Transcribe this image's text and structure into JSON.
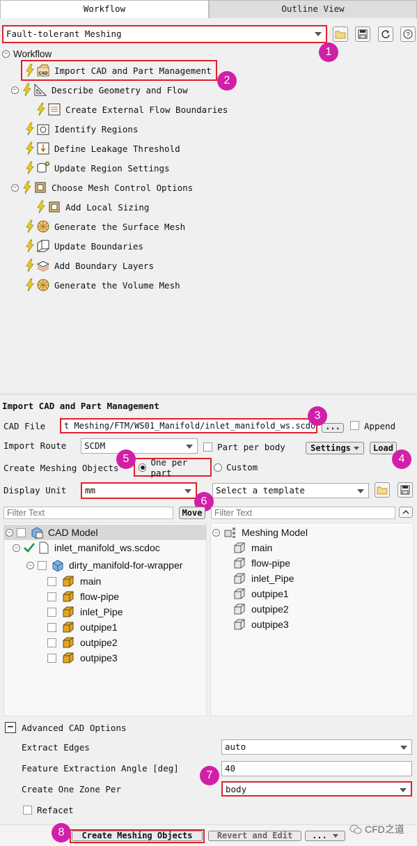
{
  "tabs": {
    "workflow": "Workflow",
    "outline": "Outline View"
  },
  "workflow_select": {
    "value": "Fault-tolerant Meshing"
  },
  "workflow": {
    "root": "Workflow",
    "items": [
      {
        "label": "Import CAD and Part Management"
      },
      {
        "label": "Describe Geometry and Flow"
      },
      {
        "label": "Create External Flow Boundaries"
      },
      {
        "label": "Identify Regions"
      },
      {
        "label": "Define Leakage Threshold"
      },
      {
        "label": "Update Region Settings"
      },
      {
        "label": "Choose Mesh Control Options"
      },
      {
        "label": "Add Local Sizing"
      },
      {
        "label": "Generate the Surface Mesh"
      },
      {
        "label": "Update Boundaries"
      },
      {
        "label": "Add Boundary Layers"
      },
      {
        "label": "Generate the Volume Mesh"
      }
    ]
  },
  "badges": [
    "1",
    "2",
    "3",
    "4",
    "5",
    "6",
    "7",
    "8"
  ],
  "task": {
    "title": "Import CAD and Part Management",
    "cad_file_label": "CAD File",
    "cad_file_value": "t Meshing/FTM/WS01_Manifold/inlet_manifold_ws.scdoc",
    "browse": "...",
    "append": "Append",
    "import_route_label": "Import Route",
    "import_route_value": "SCDM",
    "part_per_body": "Part per body",
    "settings": "Settings",
    "load": "Load",
    "create_objects_label": "Create Meshing Objects",
    "one_per_part": "One per part",
    "custom": "Custom",
    "display_unit_label": "Display Unit",
    "display_unit_value": "mm",
    "template_placeholder": "Select a template",
    "filter_placeholder": "Filter Text",
    "move": "Move"
  },
  "cad_tree": {
    "root": "CAD Model",
    "file": "inlet_manifold_ws.scdoc",
    "assembly": "dirty_manifold-for-wrapper",
    "parts": [
      "main",
      "flow-pipe",
      "inlet_Pipe",
      "outpipe1",
      "outpipe2",
      "outpipe3"
    ]
  },
  "mesh_tree": {
    "root": "Meshing Model",
    "parts": [
      "main",
      "flow-pipe",
      "inlet_Pipe",
      "outpipe1",
      "outpipe2",
      "outpipe3"
    ]
  },
  "advanced": {
    "title": "Advanced CAD Options",
    "extract_edges_label": "Extract Edges",
    "extract_edges_value": "auto",
    "angle_label": "Feature Extraction Angle [deg]",
    "angle_value": "40",
    "zone_label": "Create One Zone Per",
    "zone_value": "body",
    "refacet": "Refacet"
  },
  "footer": {
    "create": "Create Meshing Objects",
    "revert": "Revert and Edit",
    "more": "..."
  },
  "watermark": "CFD之道",
  "colors": {
    "highlight": "#e0202a",
    "badge": "#d21fa8",
    "bolt": "#f2d21b"
  }
}
